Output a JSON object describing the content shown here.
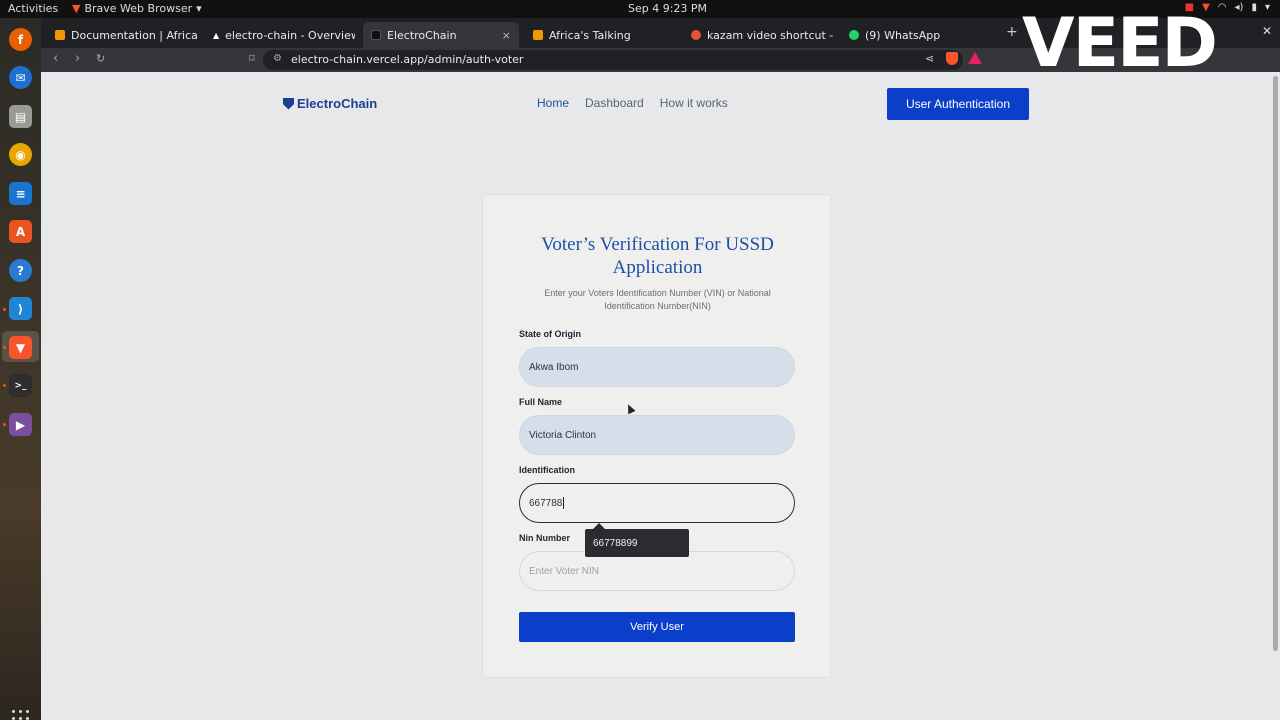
{
  "system": {
    "activities": "Activities",
    "app_name": "Brave Web Browser",
    "clock": "Sep 4  9:23 PM"
  },
  "browser": {
    "tabs": [
      {
        "label": "Documentation | Africa's Tal",
        "color": "#f29900"
      },
      {
        "label": "electro-chain - Overview – V",
        "color": "#ffffff"
      },
      {
        "label": "ElectroChain",
        "color": "#111111",
        "active": true
      },
      {
        "label": "Africa's Talking",
        "color": "#f29900"
      },
      {
        "label": "kazam video shortcut - Brave",
        "color": "#e8503a"
      },
      {
        "label": "(9) WhatsApp",
        "color": "#25d366"
      }
    ],
    "tab_close": "×",
    "new_tab": "+",
    "url": "electro-chain.vercel.app/admin/auth-voter"
  },
  "watermark": "VEED",
  "dock": {
    "icons": [
      "firefox-icon",
      "thunderbird-icon",
      "files-icon",
      "rhythmbox-icon",
      "writer-icon",
      "app-center-icon",
      "help-icon",
      "vscode-icon",
      "brave-icon",
      "terminal-icon",
      "video-editor-icon"
    ]
  },
  "site": {
    "logo": "ElectroChain",
    "nav": {
      "home": "Home",
      "dashboard": "Dashboard",
      "how": "How it works"
    },
    "auth_button": "User Authentication"
  },
  "form": {
    "title": "Voter’s Verification For USSD Application",
    "subtitle": "Enter your Voters Identification Number (VIN) or National Identification Number(NIN)",
    "state_label": "State of Origin",
    "state_value": "Akwa Ibom",
    "name_label": "Full Name",
    "name_value": "Victoria Clinton",
    "id_label": "Identification",
    "id_value": "667788",
    "autocomplete_suggestion": "66778899",
    "nin_label": "Nin Number",
    "nin_placeholder": "Enter Voter NIN",
    "submit": "Verify User"
  },
  "colors": {
    "primary": "#0b3fc9",
    "brand": "#1c3f94",
    "title": "#1c4fa8"
  }
}
